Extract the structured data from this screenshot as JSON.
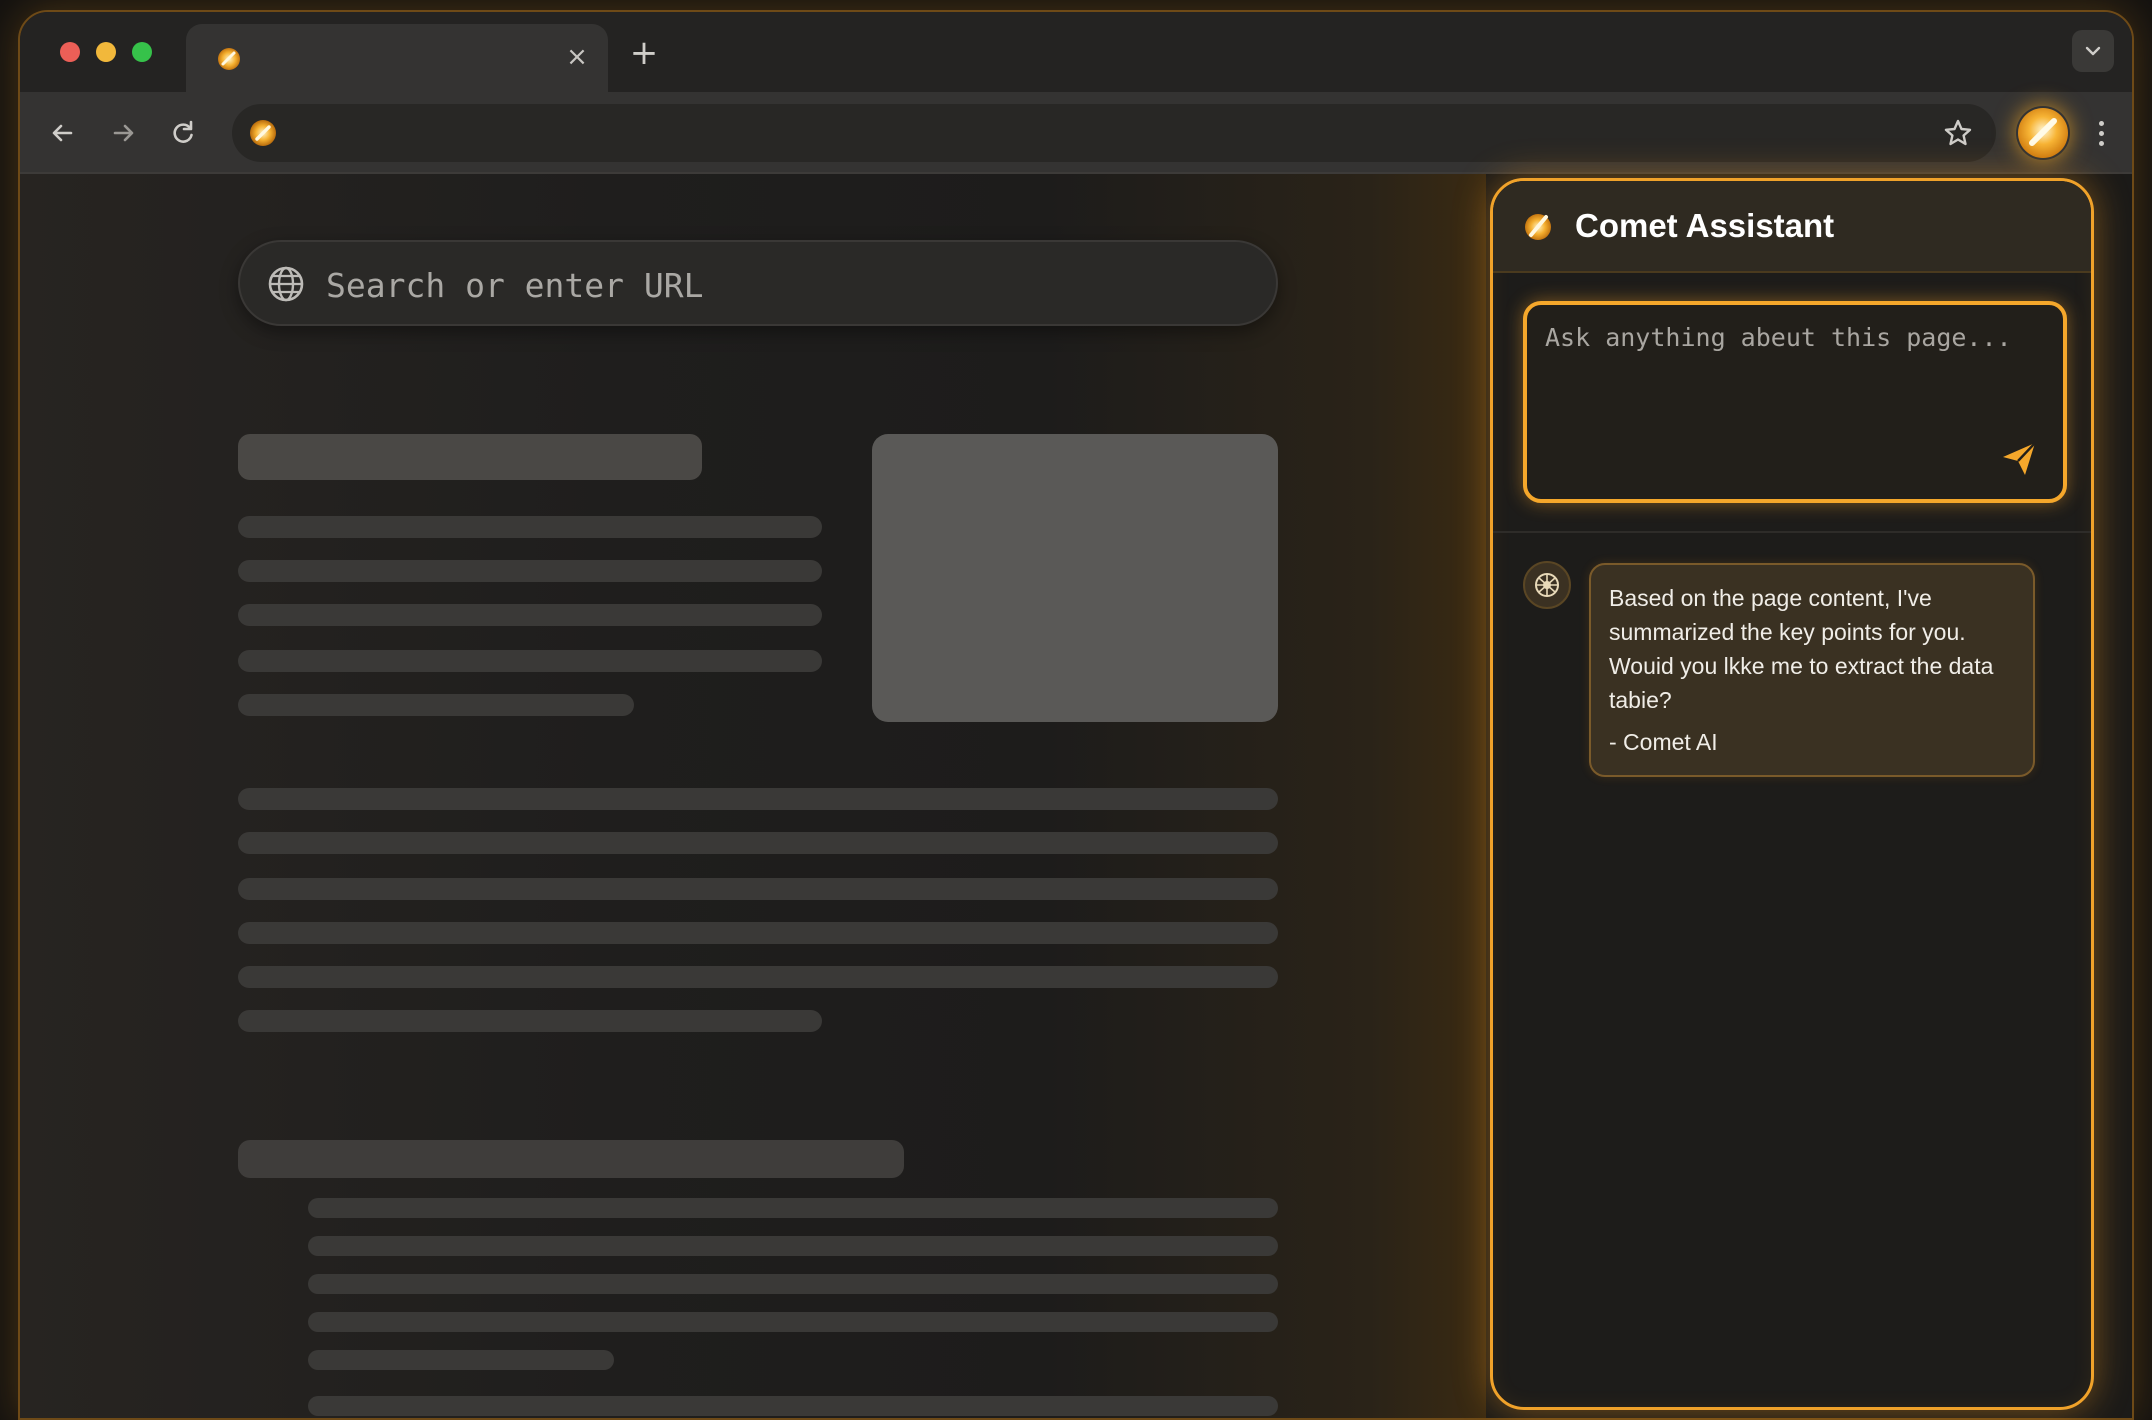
{
  "browser": {
    "tab": {
      "close_glyph": "×",
      "favicon": "comet-icon"
    },
    "new_tab_glyph": "+",
    "toolbar": {
      "icons": [
        "back-arrow-icon",
        "forward-arrow-icon",
        "reload-icon",
        "star-icon",
        "comet-extension-icon",
        "kebab-menu-icon"
      ]
    }
  },
  "page": {
    "search": {
      "placeholder": "Search or enter URL",
      "icon": "globe-icon"
    }
  },
  "assistant": {
    "title": "Comet Assistant",
    "input": {
      "placeholder": "Ask anything abeut this page..."
    },
    "messages": [
      {
        "text": "Based on the page content, I've summarized the key points for you. Wouid you lkke me to extract the data tabie?",
        "signature": "- Comet AI"
      }
    ]
  },
  "colors": {
    "accent": "#f5a72b",
    "background": "#1d1c1a",
    "traffic_red": "#ec5f57",
    "traffic_yellow": "#f2b83b",
    "traffic_green": "#36c24a"
  }
}
